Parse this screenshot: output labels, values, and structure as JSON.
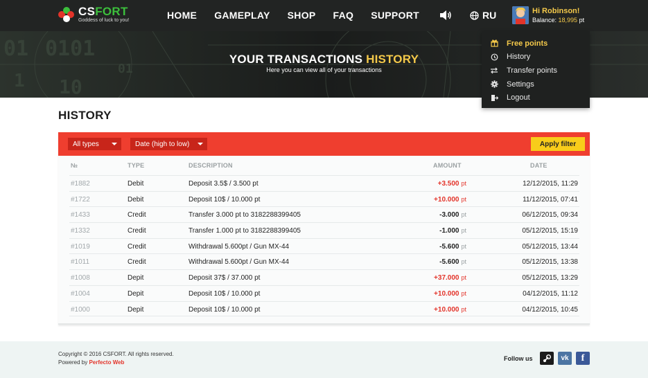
{
  "brand": {
    "name_part1": "CS",
    "name_part2": "FORT",
    "tagline": "Goddess of luck to you!"
  },
  "nav": {
    "items": [
      "HOME",
      "GAMEPLAY",
      "SHOP",
      "FAQ",
      "SUPPORT"
    ]
  },
  "language": "RU",
  "user": {
    "greeting": "Hi Robinson!",
    "balance_label": "Balance: ",
    "balance_value": "18,995",
    "balance_unit": " pt"
  },
  "dropdown": {
    "items": [
      {
        "label": "Free points",
        "icon": "gift-icon",
        "active": true
      },
      {
        "label": "History",
        "icon": "history-icon"
      },
      {
        "label": "Transfer points",
        "icon": "transfer-icon"
      },
      {
        "label": "Settings",
        "icon": "gear-icon"
      },
      {
        "label": "Logout",
        "icon": "logout-icon"
      }
    ]
  },
  "hero": {
    "title_part1": "YOUR TRANSACTIONS ",
    "title_part2": "HISTORY",
    "subtitle": "Here you can view all of your transactions"
  },
  "page_title": "HISTORY",
  "filters": {
    "type": "All types",
    "sort": "Date (high to low)",
    "apply": "Apply filter"
  },
  "table": {
    "headers": {
      "no": "№",
      "type": "TYPE",
      "description": "DESCRIPTION",
      "amount": "AMOUNT",
      "date": "DATE"
    },
    "unit": "pt",
    "rows": [
      {
        "no": "#1882",
        "type": "Debit",
        "description": "Deposit 3.5$ / 3.500 pt",
        "amount": "+3.500",
        "positive": true,
        "date": "12/12/2015, 11:29"
      },
      {
        "no": "#1722",
        "type": "Debit",
        "description": "Deposit 10$ / 10.000 pt",
        "amount": "+10.000",
        "positive": true,
        "date": "11/12/2015, 07:41"
      },
      {
        "no": "#1433",
        "type": "Credit",
        "description": "Transfer 3.000 pt to 3182288399405",
        "amount": "-3.000",
        "positive": false,
        "date": "06/12/2015, 09:34"
      },
      {
        "no": "#1332",
        "type": "Credit",
        "description": "Transfer 1.000 pt to 3182288399405",
        "amount": "-1.000",
        "positive": false,
        "date": "05/12/2015, 15:19"
      },
      {
        "no": "#1019",
        "type": "Credit",
        "description": "Withdrawal 5.600pt / Gun MX-44",
        "amount": "-5.600",
        "positive": false,
        "date": "05/12/2015, 13:44"
      },
      {
        "no": "#1011",
        "type": "Credit",
        "description": "Withdrawal 5.600pt / Gun MX-44",
        "amount": "-5.600",
        "positive": false,
        "date": "05/12/2015, 13:38"
      },
      {
        "no": "#1008",
        "type": "Depit",
        "description": "Deposit 37$ / 37.000 pt",
        "amount": "+37.000",
        "positive": true,
        "date": "05/12/2015, 13:29"
      },
      {
        "no": "#1004",
        "type": "Depit",
        "description": "Deposit 10$ / 10.000 pt",
        "amount": "+10.000",
        "positive": true,
        "date": "04/12/2015, 11:12"
      },
      {
        "no": "#1000",
        "type": "Depit",
        "description": "Deposit 10$ / 10.000 pt",
        "amount": "+10.000",
        "positive": true,
        "date": "04/12/2015, 10:45"
      }
    ]
  },
  "footer": {
    "copyright": "Copyright  © 2016 CSFORT. All rights reserved.",
    "powered_label": "Powered by ",
    "powered_brand": "Perfecto Web",
    "follow": "Follow us",
    "social": [
      {
        "name": "steam-icon",
        "color": "#1b1b1b"
      },
      {
        "name": "vk-icon",
        "color": "#4c75a3"
      },
      {
        "name": "facebook-icon",
        "color": "#3b5998"
      }
    ]
  },
  "colors": {
    "accent_red": "#ef3e2f",
    "accent_yellow": "#f4c94a",
    "dark": "#222423"
  }
}
